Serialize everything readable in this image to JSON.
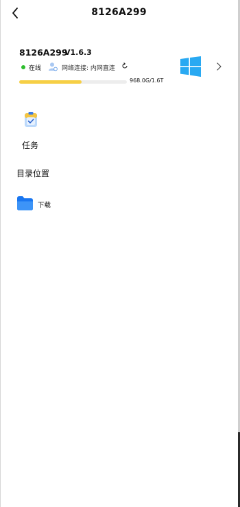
{
  "header": {
    "title": "8126A299"
  },
  "device": {
    "name": "8126A299",
    "version": "V1.6.3",
    "status": "在线",
    "network_label": "网络连接: 内网直连",
    "storage_text": "968.0G/1.6T",
    "storage_fraction": 0.58,
    "os_icon": "windows-logo-icon"
  },
  "tasks": {
    "label": "任务"
  },
  "directory": {
    "title": "目录位置",
    "folders": [
      {
        "label": "下载"
      }
    ]
  },
  "colors": {
    "online": "#2dbd2d",
    "storage_fill": "#f6cf45",
    "windows_blue": "#29a9f2",
    "folder_blue": "#1976f0"
  }
}
